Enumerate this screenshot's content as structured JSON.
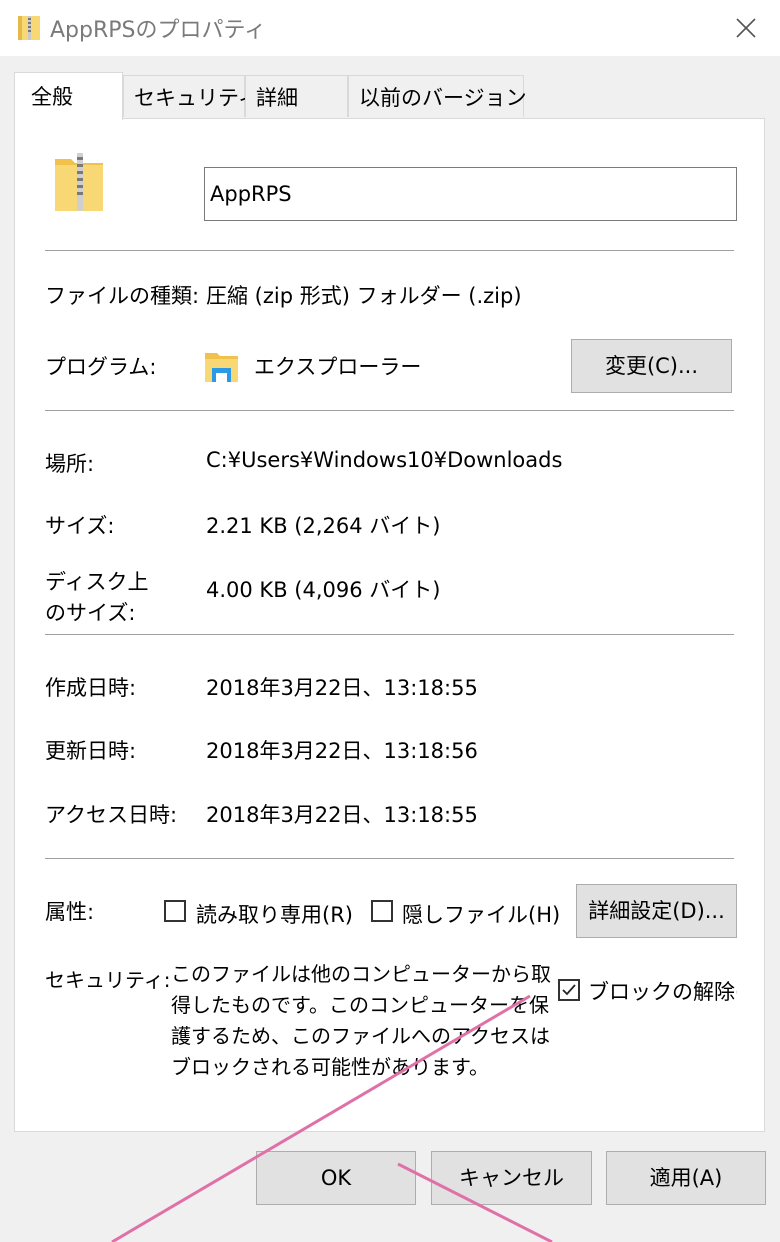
{
  "window": {
    "title": "AppRPSのプロパティ",
    "close_icon": "close-icon"
  },
  "tabs": [
    "全般",
    "セキュリティ",
    "詳細",
    "以前のバージョン"
  ],
  "general": {
    "file_name": "AppRPS",
    "file_type_label": "ファイルの種類:",
    "file_type_value": "圧縮 (zip 形式) フォルダー (.zip)",
    "program_label": "プログラム:",
    "program_value": "エクスプローラー",
    "change_button": "変更(C)...",
    "location_label": "場所:",
    "location_value": "C:¥Users¥Windows10¥Downloads",
    "size_label": "サイズ:",
    "size_value": "2.21 KB (2,264 バイト)",
    "disk_size_label_line1": "ディスク上",
    "disk_size_label_line2": "のサイズ:",
    "disk_size_value": "4.00 KB (4,096 バイト)",
    "created_label": "作成日時:",
    "created_value": "2018年3月22日、13:18:55",
    "modified_label": "更新日時:",
    "modified_value": "2018年3月22日、13:18:56",
    "accessed_label": "アクセス日時:",
    "accessed_value": "2018年3月22日、13:18:55",
    "attributes_label": "属性:",
    "readonly_label": "読み取り専用(R)",
    "readonly_checked": false,
    "hidden_label": "隠しファイル(H)",
    "hidden_checked": false,
    "advanced_button": "詳細設定(D)...",
    "security_label": "セキュリティ:",
    "security_text": "このファイルは他のコンピューターから取得したものです。このコンピューターを保護するため、このファイルへのアクセスはブロックされる可能性があります。",
    "unblock_label": "ブロックの解除(K)",
    "unblock_checked": true
  },
  "footer": {
    "ok": "OK",
    "cancel": "キャンセル",
    "apply": "適用(A)"
  },
  "colors": {
    "annotation_line": "#e070a8",
    "folder_yellow": "#f8d775",
    "explorer_blue": "#2b9ae6"
  }
}
